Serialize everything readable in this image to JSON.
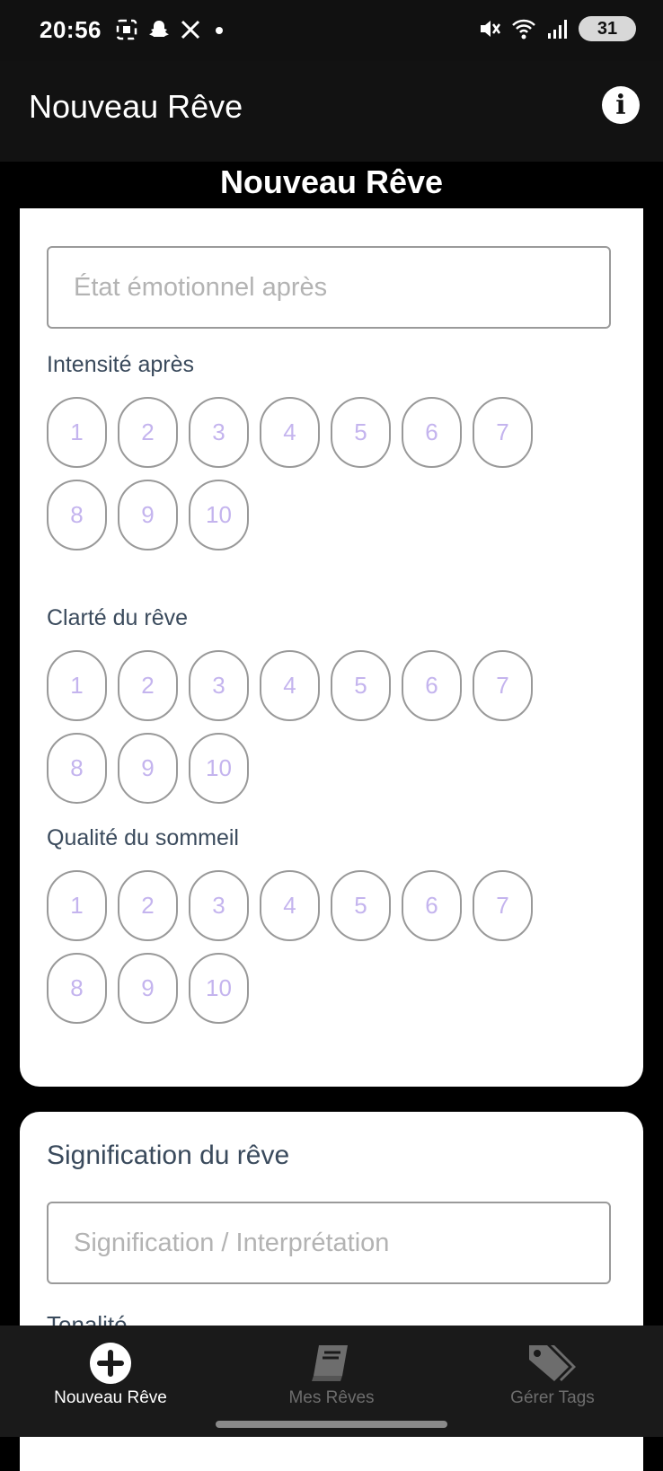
{
  "status_bar": {
    "time": "20:56",
    "battery": "31",
    "icons_left": [
      "screenshot-icon",
      "snapchat-icon",
      "x-icon",
      "dot-icon"
    ],
    "icons_right": [
      "mute-icon",
      "wifi-icon",
      "signal-icon",
      "battery-icon"
    ]
  },
  "app_bar": {
    "title": "Nouveau Rêve",
    "info_icon": "info-icon"
  },
  "page_heading": "Nouveau Rêve",
  "form": {
    "emotional_state_after": {
      "value": "",
      "placeholder": "État émotionnel après"
    },
    "ratings": [
      {
        "label": "Intensité après",
        "options": [
          "1",
          "2",
          "3",
          "4",
          "5",
          "6",
          "7",
          "8",
          "9",
          "10"
        ],
        "selected": null
      },
      {
        "label": "Clarté du rêve",
        "options": [
          "1",
          "2",
          "3",
          "4",
          "5",
          "6",
          "7",
          "8",
          "9",
          "10"
        ],
        "selected": null
      },
      {
        "label": "Qualité du sommeil",
        "options": [
          "1",
          "2",
          "3",
          "4",
          "5",
          "6",
          "7",
          "8",
          "9",
          "10"
        ],
        "selected": null
      }
    ],
    "meaning_section": {
      "title": "Signification du rêve",
      "input": {
        "value": "",
        "placeholder": "Signification / Interprétation"
      },
      "next_label": "Tonalité"
    }
  },
  "bottom_nav": {
    "items": [
      {
        "label": "Nouveau Rêve",
        "icon": "add-circle-icon",
        "active": true
      },
      {
        "label": "Mes Rêves",
        "icon": "book-icon",
        "active": false
      },
      {
        "label": "Gérer Tags",
        "icon": "tags-icon",
        "active": false
      }
    ]
  },
  "colors": {
    "background": "#000000",
    "app_bar": "#121212",
    "card": "#ffffff",
    "rating_text": "#c4b4ee",
    "label_text": "#3a4a5c",
    "nav_inactive": "#6d6d6d"
  }
}
